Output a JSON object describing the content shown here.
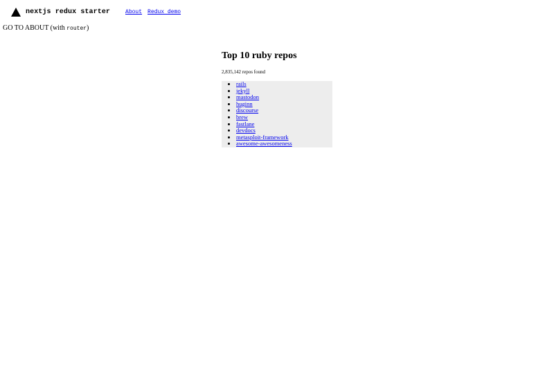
{
  "header": {
    "logo_icon": "triangle-logo-icon",
    "brand": "nextjs redux starter",
    "nav": [
      {
        "label": "About"
      },
      {
        "label": "Redux demo"
      }
    ]
  },
  "go_about": {
    "text": "GO TO ABOUT",
    "with_prefix": " (with ",
    "code": "router",
    "suffix": ")"
  },
  "main": {
    "title": "Top 10 ruby repos",
    "count_text": "2,835,142 repos found",
    "repos": [
      "rails",
      "jekyll",
      "mastodon",
      "huginn",
      "discourse",
      "brew",
      "fastlane",
      "devdocs",
      "metasploit-framework",
      "awesome-awesomeness"
    ]
  },
  "colors": {
    "link": "#0000ee",
    "list_background": "#ededed"
  }
}
